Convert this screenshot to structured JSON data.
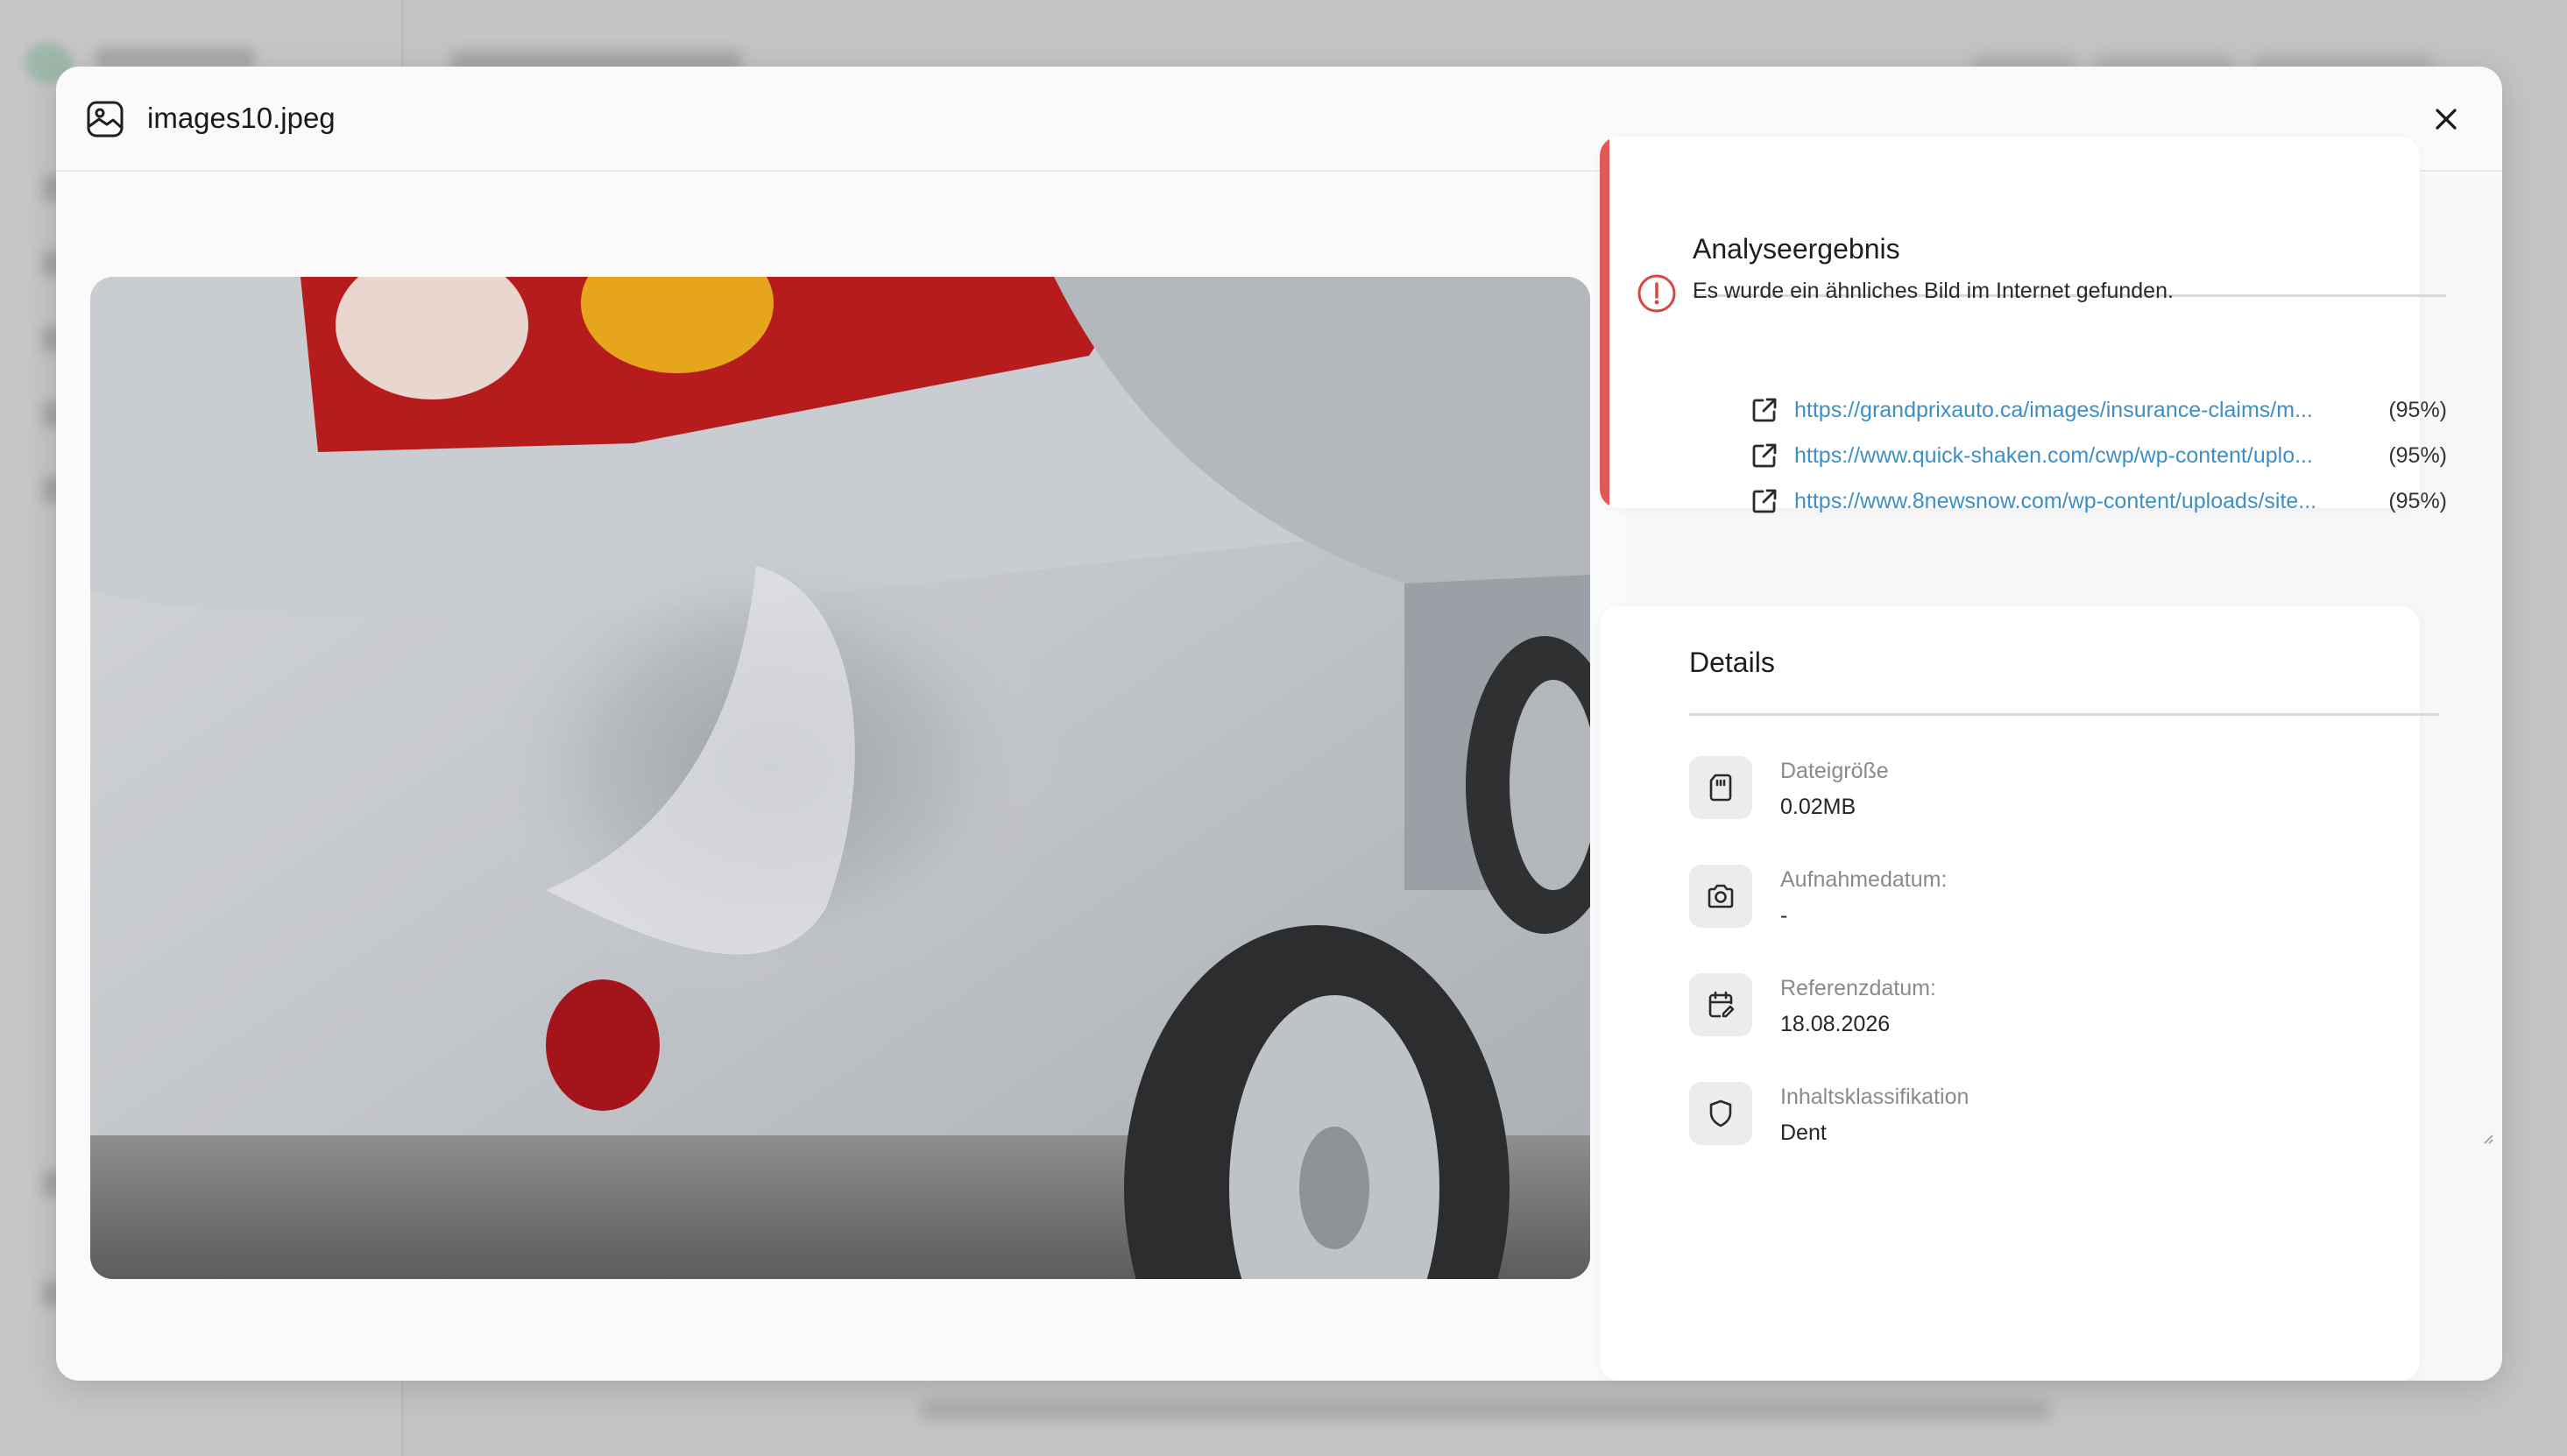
{
  "modal": {
    "title": "images10.jpeg"
  },
  "analysis": {
    "title": "Analyseergebnis",
    "message": "Es wurde ein ähnliches Bild im Internet gefunden.",
    "links": [
      {
        "url": "https://grandprixauto.ca/images/insurance-claims/m...",
        "score": "(95%)"
      },
      {
        "url": "https://www.quick-shaken.com/cwp/wp-content/uplo...",
        "score": "(95%)"
      },
      {
        "url": "https://www.8newsnow.com/wp-content/uploads/site...",
        "score": "(95%)"
      }
    ]
  },
  "details": {
    "title": "Details",
    "items": [
      {
        "label": "Dateigröße",
        "value": "0.02MB",
        "icon": "sd-card-icon"
      },
      {
        "label": "Aufnahmedatum:",
        "value": "-",
        "icon": "camera-icon"
      },
      {
        "label": "Referenzdatum:",
        "value": "18.08.2026",
        "icon": "calendar-edit-icon"
      },
      {
        "label": "Inhaltsklassifikation",
        "value": "Dent",
        "icon": "shield-icon"
      }
    ]
  },
  "colors": {
    "accent_red": "#de5a56",
    "link_blue": "#3d8fc6"
  }
}
